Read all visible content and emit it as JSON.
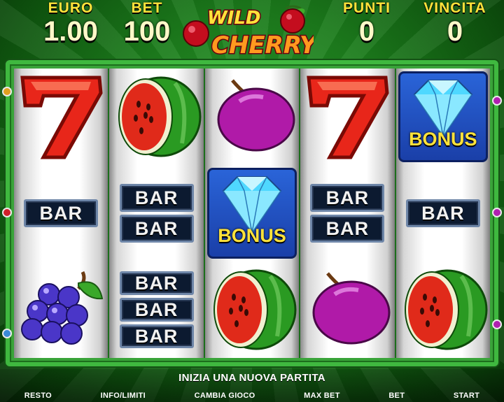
{
  "header": {
    "euro_label": "EURO",
    "euro_value": "1.00",
    "bet_label": "BET",
    "bet_value": "100",
    "punti_label": "PUNTI",
    "punti_value": "0",
    "vincita_label": "VINCITA",
    "vincita_value": "0"
  },
  "logo": {
    "line1": "WILD",
    "line2": "CHERRY"
  },
  "reels": [
    [
      "seven",
      "bar-1",
      "grapes"
    ],
    [
      "watermelon",
      "bar-2",
      "bar-3"
    ],
    [
      "plum",
      "bonus",
      "watermelon"
    ],
    [
      "seven",
      "bar-2",
      "plum"
    ],
    [
      "bonus",
      "bar-1",
      "watermelon"
    ]
  ],
  "symbols": {
    "bar_label": "BAR",
    "bonus_label": "BONUS"
  },
  "message": "INIZIA UNA NUOVA PARTITA",
  "buttons": {
    "resto": "RESTO",
    "info": "INFO/LIMITI",
    "cambia": "CAMBIA GIOCO",
    "maxbet": "MAX BET",
    "bet": "BET",
    "start": "START"
  },
  "colors": {
    "header_label": "#ffe23a",
    "header_value": "#fff8c8",
    "felt_green": "#1b7a1b",
    "bonus_text": "#ffe23a"
  }
}
